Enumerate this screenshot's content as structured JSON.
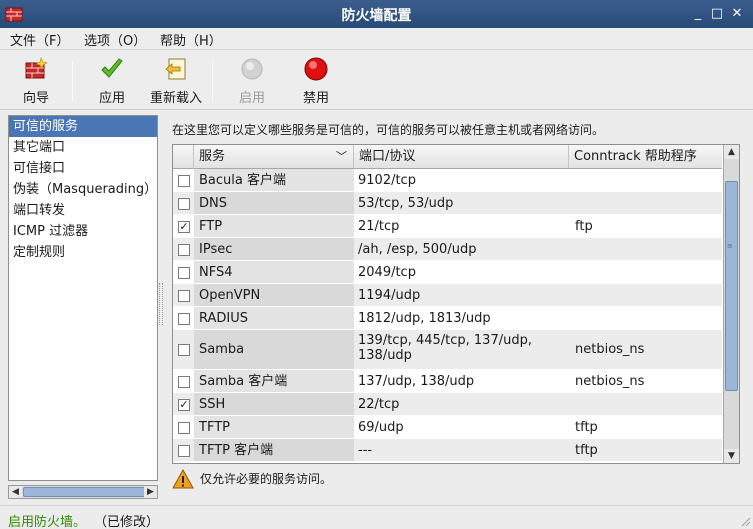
{
  "window": {
    "title": "防火墙配置",
    "controls": {
      "minimize": "_",
      "maximize": "□",
      "close": "✕"
    }
  },
  "menu": [
    {
      "label": "文件（F）"
    },
    {
      "label": "选项（O）"
    },
    {
      "label": "帮助（H）"
    }
  ],
  "toolbar": {
    "wizard": "向导",
    "apply": "应用",
    "reload": "重新载入",
    "enable": "启用",
    "disable": "禁用"
  },
  "sidebar": {
    "items": [
      {
        "label": "可信的服务",
        "selected": true
      },
      {
        "label": "其它端口"
      },
      {
        "label": "可信接口"
      },
      {
        "label": "伪装（Masquerading）"
      },
      {
        "label": "端口转发"
      },
      {
        "label": "ICMP 过滤器"
      },
      {
        "label": "定制规则"
      }
    ]
  },
  "main": {
    "description": "在这里您可以定义哪些服务是可信的，可信的服务可以被任意主机或者网络访问。",
    "columns": {
      "service": "服务",
      "ports": "端口/协议",
      "helper": "Conntrack 帮助程序"
    },
    "rows": [
      {
        "checked": false,
        "check": "",
        "service": "Bacula 客户端",
        "ports": "9102/tcp",
        "helper": ""
      },
      {
        "checked": false,
        "check": "",
        "service": "DNS",
        "ports": "53/tcp, 53/udp",
        "helper": ""
      },
      {
        "checked": true,
        "check": "✓",
        "service": "FTP",
        "ports": "21/tcp",
        "helper": "ftp"
      },
      {
        "checked": false,
        "check": "",
        "service": "IPsec",
        "ports": "/ah, /esp, 500/udp",
        "helper": ""
      },
      {
        "checked": false,
        "check": "",
        "service": "NFS4",
        "ports": "2049/tcp",
        "helper": ""
      },
      {
        "checked": false,
        "check": "",
        "service": "OpenVPN",
        "ports": "1194/udp",
        "helper": ""
      },
      {
        "checked": false,
        "check": "",
        "service": "RADIUS",
        "ports": "1812/udp, 1813/udp",
        "helper": ""
      },
      {
        "checked": false,
        "check": "",
        "service": "Samba",
        "ports": "139/tcp, 445/tcp, 137/udp, 138/udp",
        "helper": "netbios_ns"
      },
      {
        "checked": false,
        "check": "",
        "service": "Samba 客户端",
        "ports": "137/udp, 138/udp",
        "helper": "netbios_ns"
      },
      {
        "checked": true,
        "check": "✓",
        "service": "SSH",
        "ports": "22/tcp",
        "helper": ""
      },
      {
        "checked": false,
        "check": "",
        "service": "TFTP",
        "ports": "69/udp",
        "helper": "tftp"
      },
      {
        "checked": false,
        "check": "",
        "service": "TFTP 客户端",
        "ports": "---",
        "helper": "tftp"
      }
    ],
    "warning": "仅允许必要的服务访问。"
  },
  "status": {
    "state": "启用防火墙。",
    "modified": "（已修改）",
    "state_color": "#2e8b00"
  },
  "colors": {
    "titlebar": "#2f5283",
    "selection": "#4a77b4",
    "ok_green": "#2e8b00"
  }
}
